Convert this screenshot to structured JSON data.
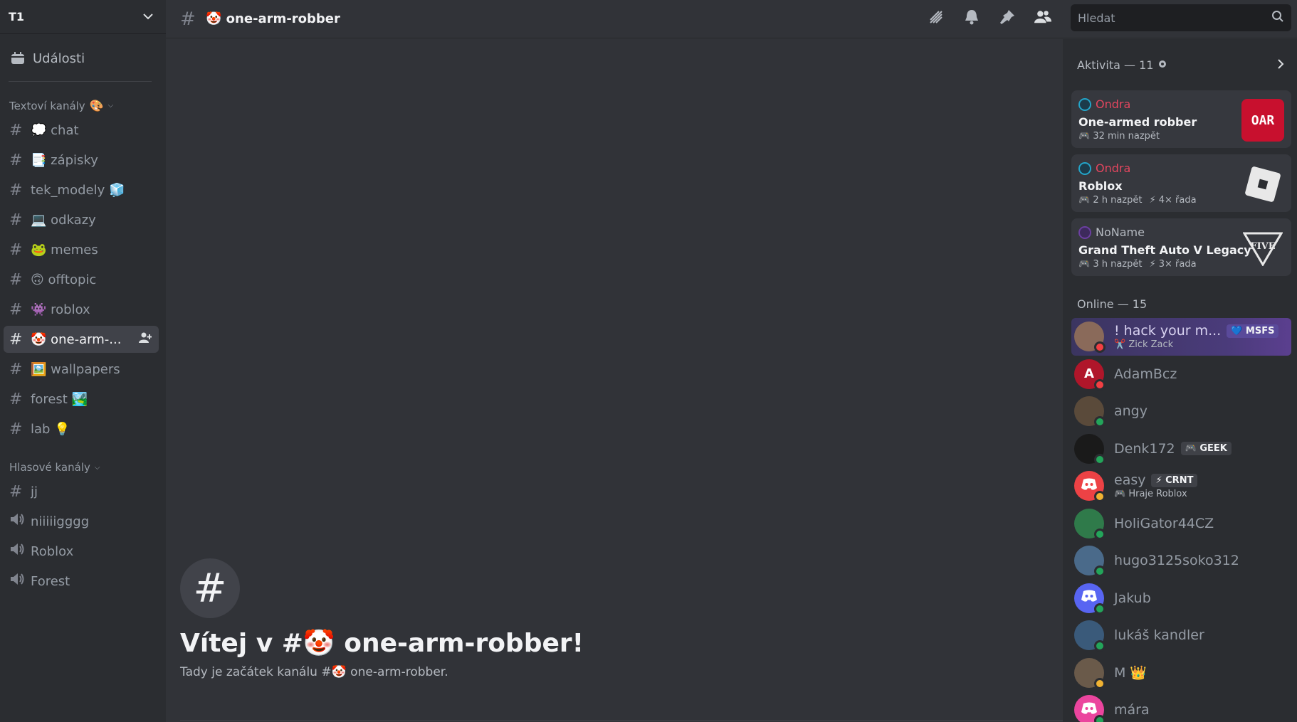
{
  "server": {
    "name": "T1"
  },
  "sidebar": {
    "events_label": "Události",
    "text_category": "Textoví kanály",
    "text_category_emoji": "🎨",
    "voice_category": "Hlasové kanály",
    "text_channels": [
      {
        "label": "💭 chat"
      },
      {
        "label": "📑 zápisky"
      },
      {
        "label": "tek_modely 🧊"
      },
      {
        "label": "💻 odkazy"
      },
      {
        "label": "🐸 memes"
      },
      {
        "label": "🙃 offtopic"
      },
      {
        "label": "👾 roblox"
      },
      {
        "label": "🤡 one-arm-..."
      },
      {
        "label": "🖼️ wallpapers"
      },
      {
        "label": "forest 🏞️"
      },
      {
        "label": "lab 💡"
      }
    ],
    "voice_channels": [
      {
        "label": "jj",
        "kind": "text"
      },
      {
        "label": "niiiiigggg",
        "kind": "voice"
      },
      {
        "label": "Roblox",
        "kind": "voice"
      },
      {
        "label": "Forest",
        "kind": "voice"
      }
    ]
  },
  "topbar": {
    "channel_title": "🤡 one-arm-robber",
    "search_placeholder": "Hledat"
  },
  "welcome": {
    "title": "Vítej v #🤡 one-arm-robber!",
    "subtitle": "Tady je začátek kanálu #🤡 one-arm-robber."
  },
  "activity": {
    "header": "Aktivita — 11",
    "cards": [
      {
        "user": "Ondra",
        "game": "One-armed robber",
        "time": "🎮 32 min nazpět",
        "streak": "",
        "thumb": "OAR"
      },
      {
        "user": "Ondra",
        "game": "Roblox",
        "time": "🎮 2 h nazpět",
        "streak": "⚡ 4× řada",
        "thumb": ""
      },
      {
        "user": "NoName",
        "game": "Grand Theft Auto V Legacy",
        "time": "🎮 3 h nazpět",
        "streak": "⚡ 3× řada",
        "thumb": "FIVE"
      }
    ]
  },
  "members": {
    "online_header": "Online — 15",
    "list": [
      {
        "name": "! hack your m...",
        "tag": "💙 MSFS",
        "sub": "✂️ Zick Zack",
        "status": "dnd",
        "color": "#8a6a5a",
        "glyph": ""
      },
      {
        "name": "AdamBcz",
        "tag": "",
        "sub": "",
        "status": "dnd",
        "color": "#b0162a",
        "glyph": "A"
      },
      {
        "name": "angy",
        "tag": "",
        "sub": "",
        "status": "online",
        "color": "#5a4a3a",
        "glyph": ""
      },
      {
        "name": "Denk172",
        "tag": "🎮 GEEK",
        "sub": "",
        "status": "online",
        "color": "#1a1a1a",
        "glyph": ""
      },
      {
        "name": "easy",
        "tag": "⚡ CRNT",
        "sub": "🎮 Hraje Roblox",
        "status": "idle",
        "color": "#ed4245",
        "glyph": ""
      },
      {
        "name": "HoliGator44CZ",
        "tag": "",
        "sub": "",
        "status": "online",
        "color": "#2f7a4a",
        "glyph": ""
      },
      {
        "name": "hugo3125soko312",
        "tag": "",
        "sub": "",
        "status": "online",
        "color": "#4a6a8a",
        "glyph": ""
      },
      {
        "name": "Jakub",
        "tag": "",
        "sub": "",
        "status": "online",
        "color": "#5865f2",
        "glyph": ""
      },
      {
        "name": "lukáš kandler",
        "tag": "",
        "sub": "",
        "status": "online",
        "color": "#3a5a7a",
        "glyph": ""
      },
      {
        "name": "M 👑",
        "tag": "",
        "sub": "",
        "status": "idle",
        "color": "#6a5a4a",
        "glyph": ""
      },
      {
        "name": "mára",
        "tag": "",
        "sub": "",
        "status": "online",
        "color": "#eb459e",
        "glyph": ""
      }
    ]
  }
}
